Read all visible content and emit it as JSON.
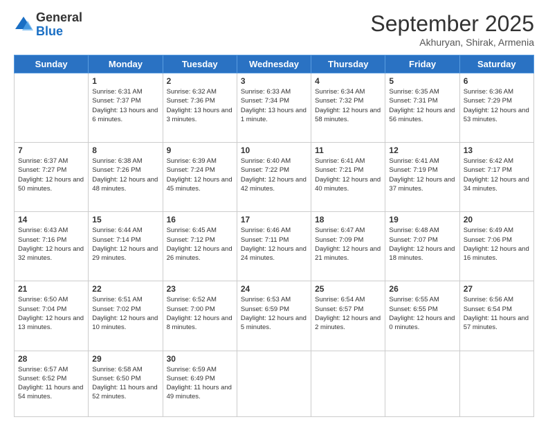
{
  "header": {
    "logo_general": "General",
    "logo_blue": "Blue",
    "month_title": "September 2025",
    "location": "Akhuryan, Shirak, Armenia"
  },
  "days_of_week": [
    "Sunday",
    "Monday",
    "Tuesday",
    "Wednesday",
    "Thursday",
    "Friday",
    "Saturday"
  ],
  "weeks": [
    [
      {
        "day": "",
        "sunrise": "",
        "sunset": "",
        "daylight": ""
      },
      {
        "day": "1",
        "sunrise": "Sunrise: 6:31 AM",
        "sunset": "Sunset: 7:37 PM",
        "daylight": "Daylight: 13 hours and 6 minutes."
      },
      {
        "day": "2",
        "sunrise": "Sunrise: 6:32 AM",
        "sunset": "Sunset: 7:36 PM",
        "daylight": "Daylight: 13 hours and 3 minutes."
      },
      {
        "day": "3",
        "sunrise": "Sunrise: 6:33 AM",
        "sunset": "Sunset: 7:34 PM",
        "daylight": "Daylight: 13 hours and 1 minute."
      },
      {
        "day": "4",
        "sunrise": "Sunrise: 6:34 AM",
        "sunset": "Sunset: 7:32 PM",
        "daylight": "Daylight: 12 hours and 58 minutes."
      },
      {
        "day": "5",
        "sunrise": "Sunrise: 6:35 AM",
        "sunset": "Sunset: 7:31 PM",
        "daylight": "Daylight: 12 hours and 56 minutes."
      },
      {
        "day": "6",
        "sunrise": "Sunrise: 6:36 AM",
        "sunset": "Sunset: 7:29 PM",
        "daylight": "Daylight: 12 hours and 53 minutes."
      }
    ],
    [
      {
        "day": "7",
        "sunrise": "Sunrise: 6:37 AM",
        "sunset": "Sunset: 7:27 PM",
        "daylight": "Daylight: 12 hours and 50 minutes."
      },
      {
        "day": "8",
        "sunrise": "Sunrise: 6:38 AM",
        "sunset": "Sunset: 7:26 PM",
        "daylight": "Daylight: 12 hours and 48 minutes."
      },
      {
        "day": "9",
        "sunrise": "Sunrise: 6:39 AM",
        "sunset": "Sunset: 7:24 PM",
        "daylight": "Daylight: 12 hours and 45 minutes."
      },
      {
        "day": "10",
        "sunrise": "Sunrise: 6:40 AM",
        "sunset": "Sunset: 7:22 PM",
        "daylight": "Daylight: 12 hours and 42 minutes."
      },
      {
        "day": "11",
        "sunrise": "Sunrise: 6:41 AM",
        "sunset": "Sunset: 7:21 PM",
        "daylight": "Daylight: 12 hours and 40 minutes."
      },
      {
        "day": "12",
        "sunrise": "Sunrise: 6:41 AM",
        "sunset": "Sunset: 7:19 PM",
        "daylight": "Daylight: 12 hours and 37 minutes."
      },
      {
        "day": "13",
        "sunrise": "Sunrise: 6:42 AM",
        "sunset": "Sunset: 7:17 PM",
        "daylight": "Daylight: 12 hours and 34 minutes."
      }
    ],
    [
      {
        "day": "14",
        "sunrise": "Sunrise: 6:43 AM",
        "sunset": "Sunset: 7:16 PM",
        "daylight": "Daylight: 12 hours and 32 minutes."
      },
      {
        "day": "15",
        "sunrise": "Sunrise: 6:44 AM",
        "sunset": "Sunset: 7:14 PM",
        "daylight": "Daylight: 12 hours and 29 minutes."
      },
      {
        "day": "16",
        "sunrise": "Sunrise: 6:45 AM",
        "sunset": "Sunset: 7:12 PM",
        "daylight": "Daylight: 12 hours and 26 minutes."
      },
      {
        "day": "17",
        "sunrise": "Sunrise: 6:46 AM",
        "sunset": "Sunset: 7:11 PM",
        "daylight": "Daylight: 12 hours and 24 minutes."
      },
      {
        "day": "18",
        "sunrise": "Sunrise: 6:47 AM",
        "sunset": "Sunset: 7:09 PM",
        "daylight": "Daylight: 12 hours and 21 minutes."
      },
      {
        "day": "19",
        "sunrise": "Sunrise: 6:48 AM",
        "sunset": "Sunset: 7:07 PM",
        "daylight": "Daylight: 12 hours and 18 minutes."
      },
      {
        "day": "20",
        "sunrise": "Sunrise: 6:49 AM",
        "sunset": "Sunset: 7:06 PM",
        "daylight": "Daylight: 12 hours and 16 minutes."
      }
    ],
    [
      {
        "day": "21",
        "sunrise": "Sunrise: 6:50 AM",
        "sunset": "Sunset: 7:04 PM",
        "daylight": "Daylight: 12 hours and 13 minutes."
      },
      {
        "day": "22",
        "sunrise": "Sunrise: 6:51 AM",
        "sunset": "Sunset: 7:02 PM",
        "daylight": "Daylight: 12 hours and 10 minutes."
      },
      {
        "day": "23",
        "sunrise": "Sunrise: 6:52 AM",
        "sunset": "Sunset: 7:00 PM",
        "daylight": "Daylight: 12 hours and 8 minutes."
      },
      {
        "day": "24",
        "sunrise": "Sunrise: 6:53 AM",
        "sunset": "Sunset: 6:59 PM",
        "daylight": "Daylight: 12 hours and 5 minutes."
      },
      {
        "day": "25",
        "sunrise": "Sunrise: 6:54 AM",
        "sunset": "Sunset: 6:57 PM",
        "daylight": "Daylight: 12 hours and 2 minutes."
      },
      {
        "day": "26",
        "sunrise": "Sunrise: 6:55 AM",
        "sunset": "Sunset: 6:55 PM",
        "daylight": "Daylight: 12 hours and 0 minutes."
      },
      {
        "day": "27",
        "sunrise": "Sunrise: 6:56 AM",
        "sunset": "Sunset: 6:54 PM",
        "daylight": "Daylight: 11 hours and 57 minutes."
      }
    ],
    [
      {
        "day": "28",
        "sunrise": "Sunrise: 6:57 AM",
        "sunset": "Sunset: 6:52 PM",
        "daylight": "Daylight: 11 hours and 54 minutes."
      },
      {
        "day": "29",
        "sunrise": "Sunrise: 6:58 AM",
        "sunset": "Sunset: 6:50 PM",
        "daylight": "Daylight: 11 hours and 52 minutes."
      },
      {
        "day": "30",
        "sunrise": "Sunrise: 6:59 AM",
        "sunset": "Sunset: 6:49 PM",
        "daylight": "Daylight: 11 hours and 49 minutes."
      },
      {
        "day": "",
        "sunrise": "",
        "sunset": "",
        "daylight": ""
      },
      {
        "day": "",
        "sunrise": "",
        "sunset": "",
        "daylight": ""
      },
      {
        "day": "",
        "sunrise": "",
        "sunset": "",
        "daylight": ""
      },
      {
        "day": "",
        "sunrise": "",
        "sunset": "",
        "daylight": ""
      }
    ]
  ]
}
